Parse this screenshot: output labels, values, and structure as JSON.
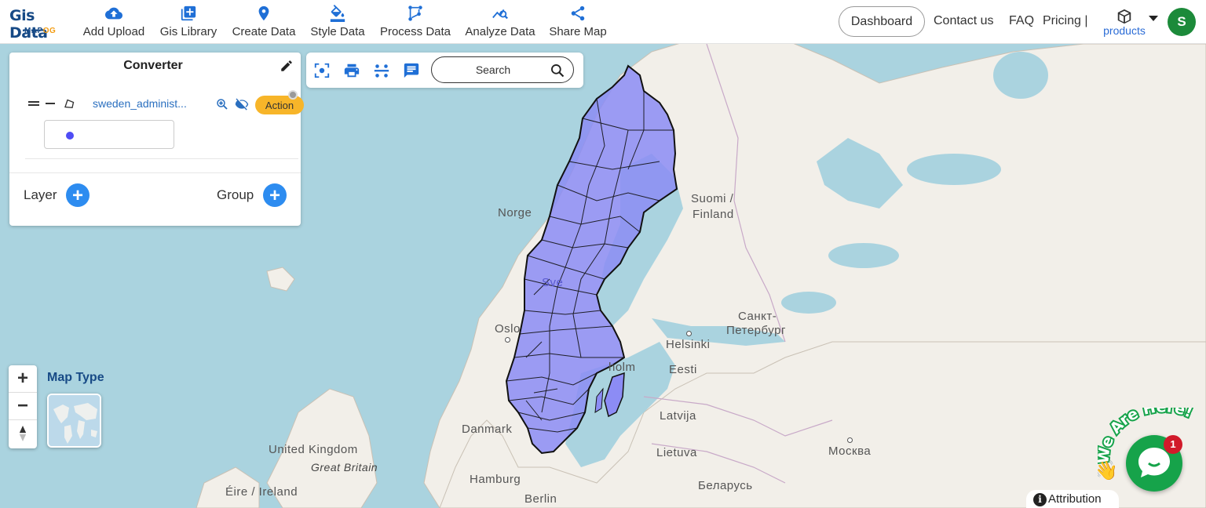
{
  "logo": {
    "main": "Gis Data",
    "sub_a": "MAP",
    "sub_b": "OG"
  },
  "nav": [
    {
      "label": "Add Upload",
      "icon": "cloud-upload-icon"
    },
    {
      "label": "Gis Library",
      "icon": "library-add-icon"
    },
    {
      "label": "Create Data",
      "icon": "location-pin-icon"
    },
    {
      "label": "Style Data",
      "icon": "paint-bucket-icon"
    },
    {
      "label": "Process Data",
      "icon": "process-nodes-icon"
    },
    {
      "label": "Analyze Data",
      "icon": "analyze-chart-icon"
    },
    {
      "label": "Share Map",
      "icon": "share-icon"
    }
  ],
  "header_right": {
    "dashboard": "Dashboard",
    "contact": "Contact us",
    "faq": "FAQ",
    "pricing": "Pricing |",
    "products": "products",
    "avatar_initial": "S"
  },
  "panel": {
    "title": "Converter",
    "layer_name": "sweden_administ...",
    "action_label": "Action",
    "layer_label": "Layer",
    "group_label": "Group",
    "legend_color": "#4f4df5"
  },
  "toolbar": {
    "search_placeholder": "Search"
  },
  "map": {
    "type_label": "Map Type",
    "labels": {
      "norge": "Norge",
      "sverige": "Sve",
      "suomi": "Suomi /",
      "finland": "Finland",
      "oslo": "Oslo",
      "helsinki": "Helsinki",
      "stockholm": "holm",
      "eesti": "Eesti",
      "spb1": "Санкт-",
      "spb2": "Петербург",
      "latvija": "Latvija",
      "lietuva": "Lietuva",
      "moskva": "Москва",
      "danmark": "Danmark",
      "uk": "United Kingdom",
      "gb": "Great Britain",
      "eire": "Éire / Ireland",
      "hamburg": "Hamburg",
      "berlin": "Berlin",
      "belarus": "Беларусь"
    },
    "fill_color": "#8c8cf5",
    "land_color": "#f2efe9",
    "water_color": "#aad3df"
  },
  "chat": {
    "badge_count": "1",
    "banner": "We Are Here!"
  },
  "attribution": {
    "icon": "i",
    "label": "Attribution"
  }
}
